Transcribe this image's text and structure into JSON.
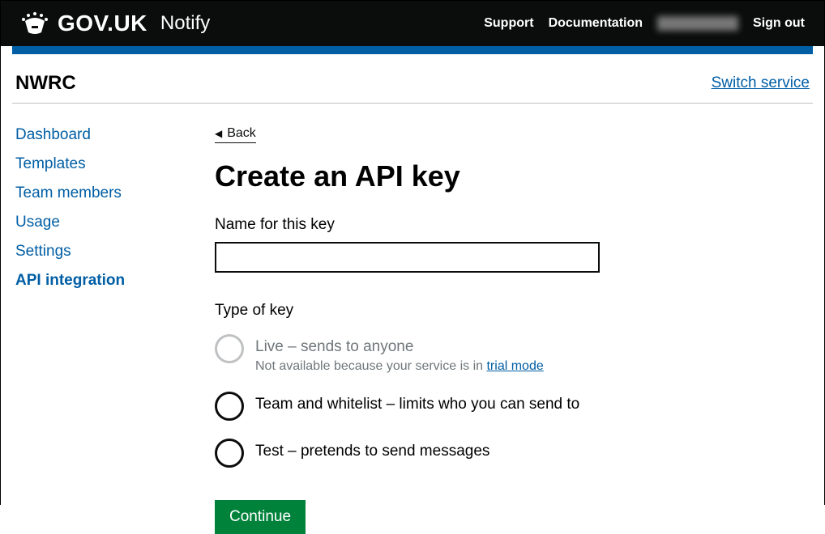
{
  "header": {
    "govuk": "GOV.UK",
    "notify": "Notify",
    "nav": {
      "support": "Support",
      "documentation": "Documentation",
      "signout": "Sign out"
    }
  },
  "service": {
    "name": "NWRC",
    "switch": "Switch service"
  },
  "sidebar": {
    "items": [
      {
        "label": "Dashboard"
      },
      {
        "label": "Templates"
      },
      {
        "label": "Team members"
      },
      {
        "label": "Usage"
      },
      {
        "label": "Settings"
      },
      {
        "label": "API integration"
      }
    ]
  },
  "main": {
    "back": "Back",
    "title": "Create an API key",
    "key_name_label": "Name for this key",
    "key_name_value": "",
    "type_label": "Type of key",
    "options": {
      "live": {
        "label": "Live – sends to anyone",
        "hint_prefix": "Not available because your service is in ",
        "hint_link": "trial mode"
      },
      "team": {
        "label": "Team and whitelist – limits who you can send to"
      },
      "test": {
        "label": "Test – pretends to send messages"
      }
    },
    "continue": "Continue"
  }
}
